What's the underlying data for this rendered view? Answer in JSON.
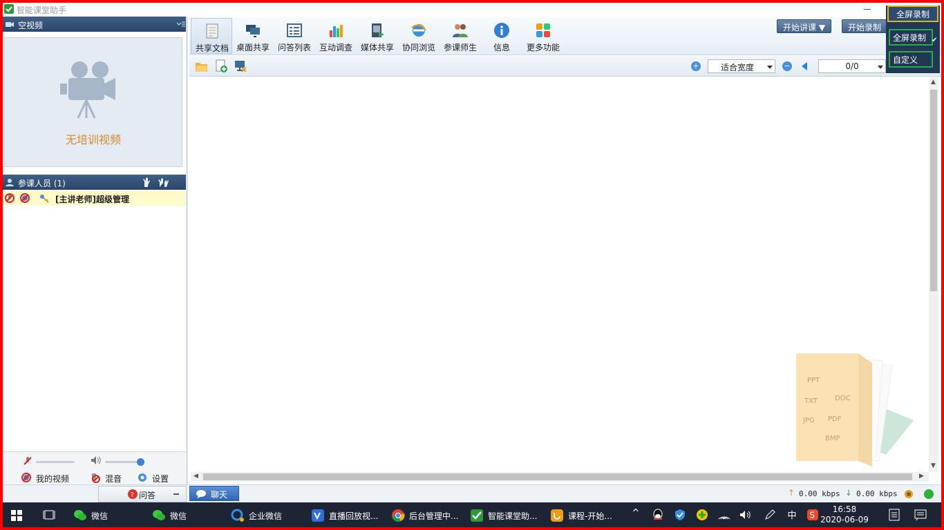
{
  "window": {
    "title": "智能课堂助手",
    "close_glyph": "×"
  },
  "video_panel": {
    "title": "空视频",
    "empty_text": "无培训视频"
  },
  "participants": {
    "title": "参课人员 (1)",
    "items": [
      {
        "name": "[主讲老师]超级管理"
      }
    ]
  },
  "left_footer": {
    "my_video": "我的视频",
    "mix_audio": "混音",
    "settings": "设置"
  },
  "toolbar": {
    "tools": [
      {
        "label": "共享文档",
        "icon": "document-icon"
      },
      {
        "label": "桌面共享",
        "icon": "desktop-share-icon"
      },
      {
        "label": "问答列表",
        "icon": "qa-list-icon"
      },
      {
        "label": "互动调查",
        "icon": "survey-chart-icon"
      },
      {
        "label": "媒体共享",
        "icon": "media-share-icon"
      },
      {
        "label": "协同浏览",
        "icon": "browser-icon"
      },
      {
        "label": "参课师生",
        "icon": "people-icon"
      },
      {
        "label": "信息",
        "icon": "info-icon"
      },
      {
        "label": "更多功能",
        "icon": "more-grid-icon"
      }
    ],
    "start_lecture": "开始讲课",
    "start_record": "开始录制"
  },
  "record_menu": {
    "options": [
      "全屏录制",
      "全屏录制",
      "自定义"
    ]
  },
  "doc_toolbar": {
    "zoom_value": "适合宽度",
    "page_value": "0/0",
    "zoom_in": "+",
    "zoom_out": "−"
  },
  "doc_watermark": {
    "formats": [
      "PPT",
      "DOC",
      "TXT",
      "PDF",
      "JPG",
      "BMP"
    ]
  },
  "statusbar": {
    "qa_label": "问答",
    "chat_label": "聊天",
    "upload": "0.00 kbps",
    "download": "0.00 kbps"
  },
  "taskbar": {
    "items": [
      {
        "label": "微信"
      },
      {
        "label": "微信"
      },
      {
        "label": "企业微信"
      },
      {
        "label": "直播回放视..."
      },
      {
        "label": "后台管理中..."
      },
      {
        "label": "智能课堂助..."
      },
      {
        "label": "课程-开始..."
      }
    ],
    "ime": "中",
    "time": "16:58",
    "date": "2020-06-09"
  },
  "colors": {
    "frame_border": "#ff0000",
    "header_blue": "#2a4669",
    "highlight_yellow": "#e5b21a",
    "highlight_green": "#2ea84a"
  }
}
